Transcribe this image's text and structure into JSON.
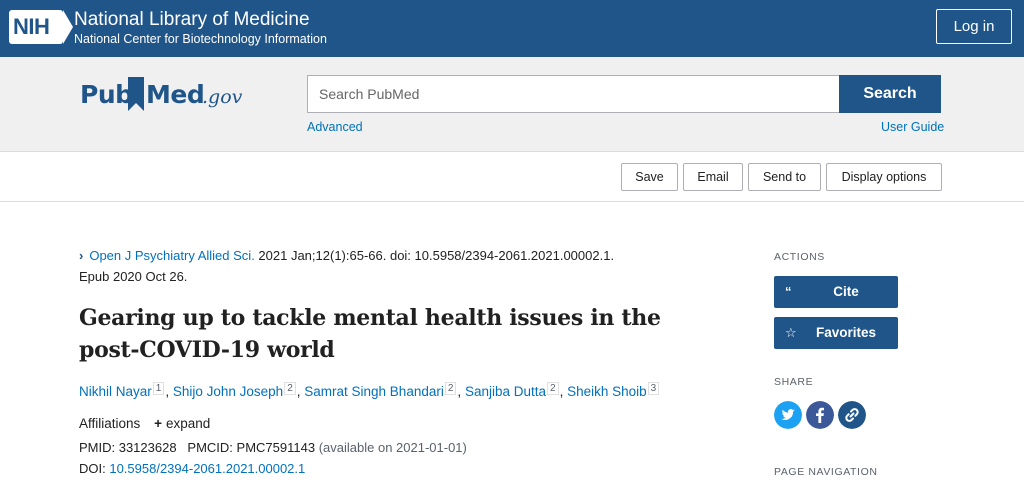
{
  "nih": {
    "logo_text": "NIH",
    "title": "National Library of Medicine",
    "subtitle": "National Center for Biotechnology Information",
    "login_label": "Log in"
  },
  "search": {
    "logo_pub": "Pub",
    "logo_med": "Med",
    "logo_gov": ".gov",
    "placeholder": "Search PubMed",
    "button_label": "Search",
    "advanced_label": "Advanced",
    "user_guide_label": "User Guide"
  },
  "toolbar": {
    "save_label": "Save",
    "email_label": "Email",
    "send_to_label": "Send to",
    "display_options_label": "Display options"
  },
  "article": {
    "journal": "Open J Psychiatry Allied Sci.",
    "citation_rest": " 2021 Jan;12(1):65-66. doi: 10.5958/2394-2061.2021.00002.1.",
    "epub": "Epub 2020 Oct 26.",
    "title_line1": "Gearing up to tackle mental health issues in the",
    "title_line2": "post-COVID-19 world",
    "authors": [
      {
        "name": "Nikhil Nayar",
        "aff": "1"
      },
      {
        "name": "Shijo John Joseph",
        "aff": "2"
      },
      {
        "name": "Samrat Singh Bhandari",
        "aff": "2"
      },
      {
        "name": "Sanjiba Dutta",
        "aff": "2"
      },
      {
        "name": "Sheikh Shoib",
        "aff": "3"
      }
    ],
    "affiliations_label": "Affiliations",
    "expand_label": "expand",
    "pmid": "PMID: 33123628",
    "pmcid": "PMCID: PMC7591143",
    "pmcid_note": "(available on 2021-01-01)",
    "doi_label": "DOI: ",
    "doi_value": "10.5958/2394-2061.2021.00002.1"
  },
  "sidebar": {
    "actions_heading": "ACTIONS",
    "cite_label": "Cite",
    "favorites_label": "Favorites",
    "share_heading": "SHARE",
    "page_nav_heading": "PAGE NAVIGATION"
  },
  "colors": {
    "brand_blue": "#20558a",
    "link_blue": "#0071bc",
    "twitter": "#1da1f2",
    "facebook": "#3b5998"
  },
  "icons": {
    "chevron": "chevron-right-icon",
    "cite": "quote-icon",
    "favorites": "star-icon",
    "twitter": "twitter-icon",
    "facebook": "facebook-icon",
    "permalink": "link-icon"
  }
}
